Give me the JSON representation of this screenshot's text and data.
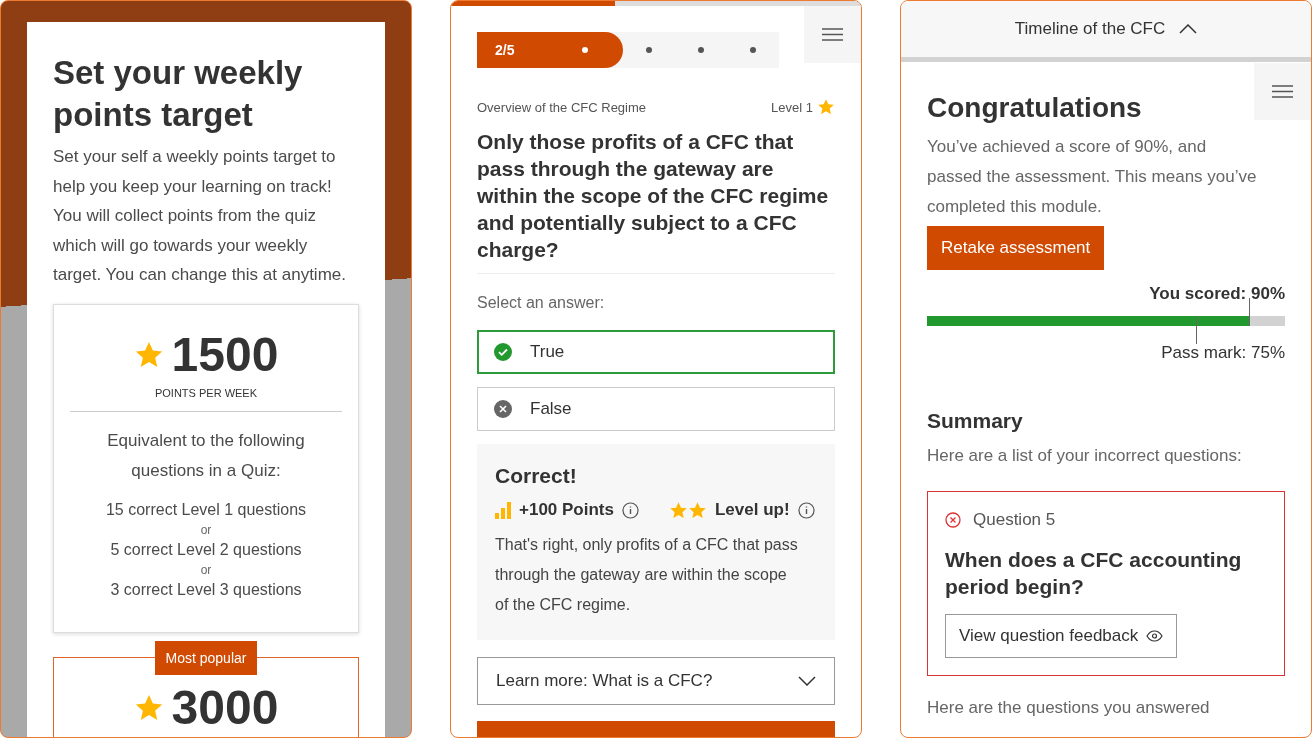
{
  "target_panel": {
    "title": "Set your weekly points target",
    "description": "Set your self a weekly points target to help you keep your learning on track! You will collect points from the quiz which will go towards your weekly target. You can change this at anytime.",
    "options": [
      {
        "points": "1500",
        "unit": "POINTS PER WEEK",
        "highlighted": false,
        "equivalent_heading": "Equivalent to the following questions in a Quiz:",
        "equivalents": [
          {
            "kind": "line",
            "text": "15 correct Level 1 questions"
          },
          {
            "kind": "separator",
            "text": "or"
          },
          {
            "kind": "line",
            "text": "5 correct Level 2 questions"
          },
          {
            "kind": "separator",
            "text": "or"
          },
          {
            "kind": "line",
            "text": "3 correct Level 3 questions"
          }
        ]
      },
      {
        "points": "3000",
        "highlighted": true,
        "badge": "Most popular"
      }
    ]
  },
  "quiz_panel": {
    "progress": {
      "level": 0.4
    },
    "stepper": {
      "label": "2/5",
      "dots": [
        {
          "completed": true
        },
        {
          "completed": false
        },
        {
          "completed": false
        },
        {
          "completed": false
        }
      ]
    },
    "topic": "Overview of the CFC Regime",
    "level_label": "Level 1",
    "question": "Only those profits of a CFC that pass through the gateway are within the scope of the CFC regime and potentially subject to a CFC charge?",
    "prompt": "Select an answer:",
    "answers": [
      {
        "label": "True",
        "selected": true,
        "correct": true
      },
      {
        "label": "False",
        "selected": false,
        "correct": false
      }
    ],
    "feedback": {
      "title": "Correct!",
      "points": "+100 Points",
      "level_up": "Level up!",
      "text": "That's right, only profits of a CFC that pass through the gateway are within the scope of the CFC regime."
    },
    "accordion": {
      "label": "Learn more: What is a CFC?",
      "expanded": false
    }
  },
  "results_panel": {
    "header": {
      "title": "Timeline of the CFC",
      "expanded": true
    },
    "title": "Congratulations",
    "text": "You’ve achieved a score of 90%, and passed the assessment. This means you’ve completed this module.",
    "retake_button": "Retake assessment",
    "score": {
      "label": "You scored: 90%",
      "level": 0.9
    },
    "pass_mark": {
      "label": "Pass mark: 75%",
      "level": 0.75
    },
    "summary_title": "Summary",
    "summary_text": "Here are a list of your incorrect questions:",
    "incorrect": [
      {
        "number": "Question 5",
        "question": "When does a CFC accounting period begin?",
        "button": "View question feedback"
      }
    ],
    "footer_text": "Here are the questions you answered"
  }
}
